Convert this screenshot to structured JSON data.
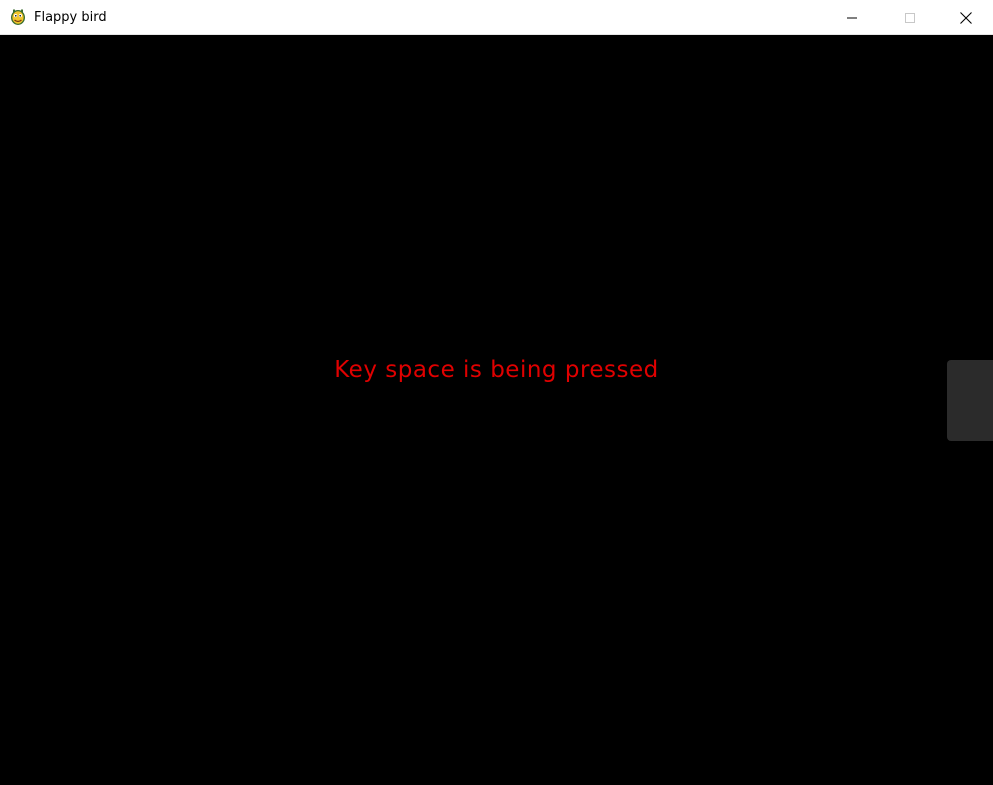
{
  "window": {
    "title": "Flappy bird",
    "icon": "pygame-snake-icon",
    "controls": {
      "minimize": "minimize-icon",
      "maximize": "maximize-icon",
      "close": "close-icon"
    }
  },
  "game": {
    "message": "Key space is being pressed",
    "message_color": "#e00000",
    "background_color": "#000000"
  },
  "side_panel": {
    "color": "#2b2b2b"
  }
}
